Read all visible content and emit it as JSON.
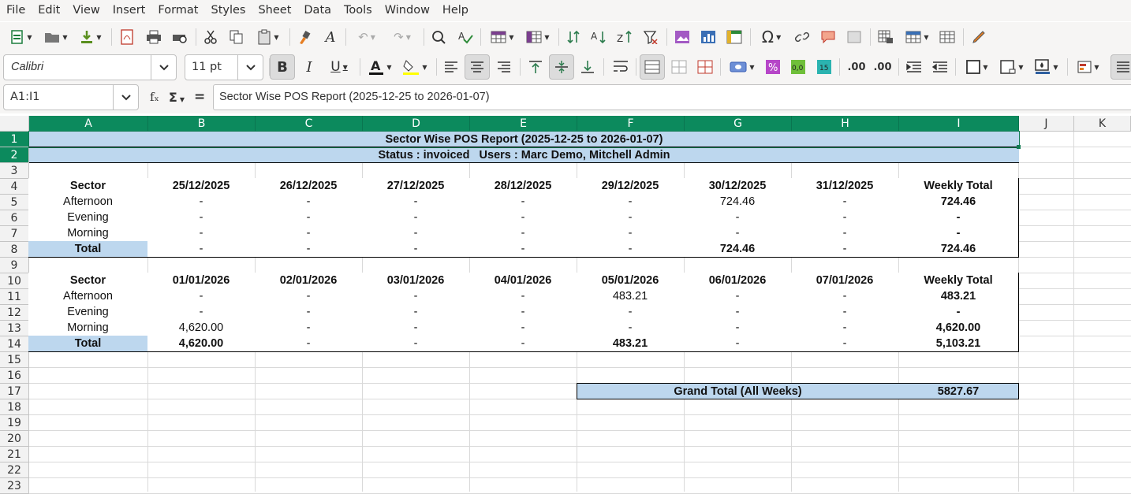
{
  "menu": [
    "File",
    "Edit",
    "View",
    "Insert",
    "Format",
    "Styles",
    "Sheet",
    "Data",
    "Tools",
    "Window",
    "Help"
  ],
  "toolbar": {
    "font_name": "Calibri",
    "font_size": "11 pt"
  },
  "formula_bar": {
    "name_box": "A1:I1",
    "fx_label": "fₓ",
    "sum_label": "Σ",
    "equals_label": "=",
    "content": "Sector Wise POS Report (2025-12-25 to 2026-01-07)"
  },
  "columns": [
    "A",
    "B",
    "C",
    "D",
    "E",
    "F",
    "G",
    "H",
    "I",
    "J",
    "K"
  ],
  "rows": [
    "1",
    "2",
    "3",
    "4",
    "5",
    "6",
    "7",
    "8",
    "9",
    "10",
    "11",
    "12",
    "13",
    "14",
    "15",
    "16",
    "17",
    "18",
    "19",
    "20",
    "21",
    "22",
    "23"
  ],
  "report": {
    "title": "Sector Wise POS Report (2025-12-25 to 2026-01-07)",
    "status": "Status : invoiced   Users : Marc Demo, Mitchell Admin",
    "week1": {
      "header": [
        "Sector",
        "25/12/2025",
        "26/12/2025",
        "27/12/2025",
        "28/12/2025",
        "29/12/2025",
        "30/12/2025",
        "31/12/2025",
        "Weekly Total"
      ],
      "rows": [
        [
          "Afternoon",
          "-",
          "-",
          "-",
          "-",
          "-",
          "724.46",
          "-",
          "724.46"
        ],
        [
          "Evening",
          "-",
          "-",
          "-",
          "-",
          "-",
          "-",
          "-",
          "-"
        ],
        [
          "Morning",
          "-",
          "-",
          "-",
          "-",
          "-",
          "-",
          "-",
          "-"
        ],
        [
          "Total",
          "-",
          "-",
          "-",
          "-",
          "-",
          "724.46",
          "-",
          "724.46"
        ]
      ]
    },
    "week2": {
      "header": [
        "Sector",
        "01/01/2026",
        "02/01/2026",
        "03/01/2026",
        "04/01/2026",
        "05/01/2026",
        "06/01/2026",
        "07/01/2026",
        "Weekly Total"
      ],
      "rows": [
        [
          "Afternoon",
          "-",
          "-",
          "-",
          "-",
          "483.21",
          "-",
          "-",
          "483.21"
        ],
        [
          "Evening",
          "-",
          "-",
          "-",
          "-",
          "-",
          "-",
          "-",
          "-"
        ],
        [
          "Morning",
          "4,620.00",
          "-",
          "-",
          "-",
          "-",
          "-",
          "-",
          "4,620.00"
        ],
        [
          "Total",
          "4,620.00",
          "-",
          "-",
          "-",
          "483.21",
          "-",
          "-",
          "5,103.21"
        ]
      ]
    },
    "grand_total_label": "Grand Total (All Weeks)",
    "grand_total_value": "5827.67"
  },
  "colors": {
    "selection_green": "#0c8a5d",
    "header_blue": "#bdd7ee"
  }
}
